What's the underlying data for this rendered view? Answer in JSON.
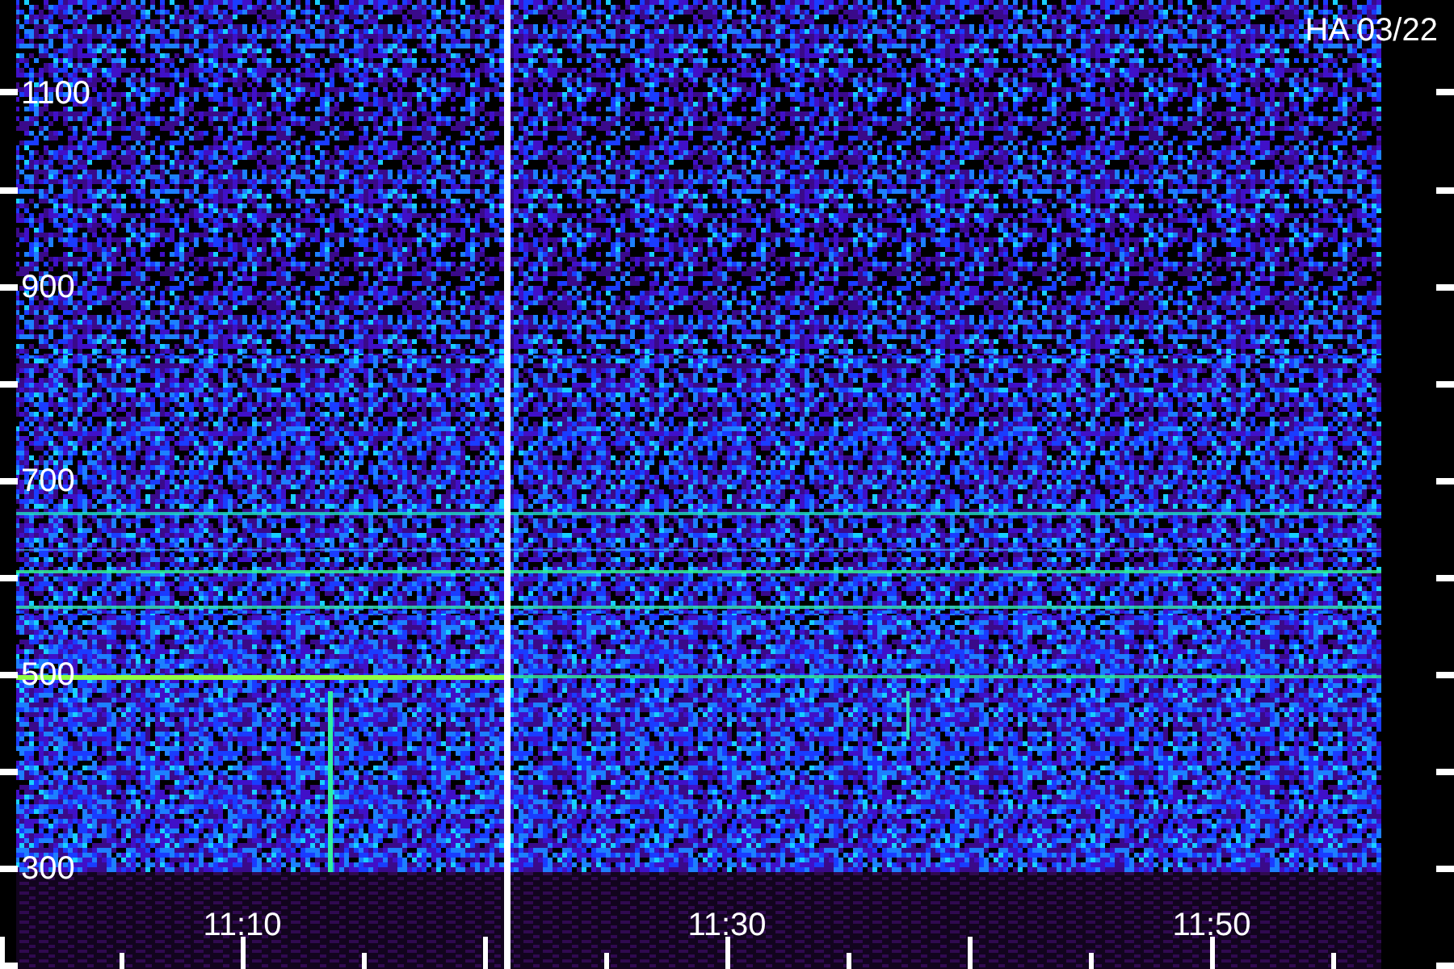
{
  "title": "HA 03/22",
  "y_axis": {
    "labels": [
      "1100",
      "900",
      "700",
      "500",
      "300"
    ]
  },
  "x_axis": {
    "labels": [
      "11:10",
      "11:30",
      "11:50"
    ]
  }
}
